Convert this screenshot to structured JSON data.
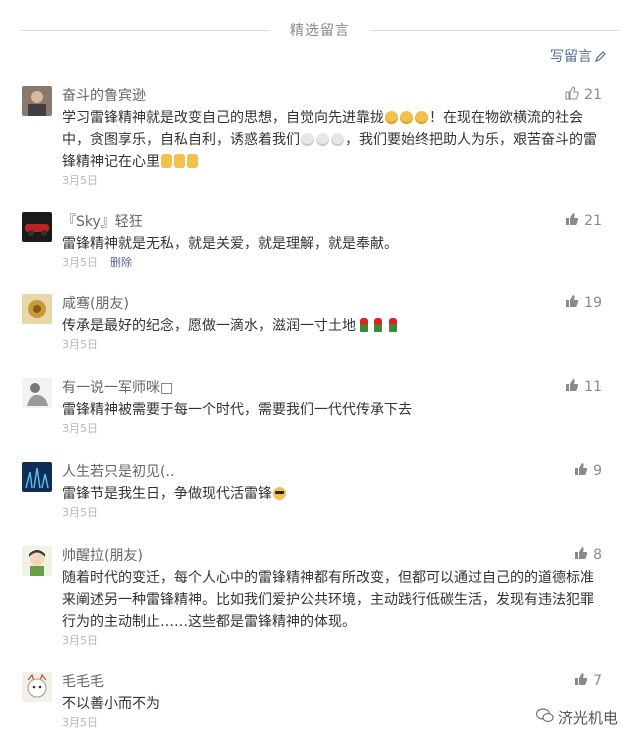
{
  "header": {
    "title": "精选留言"
  },
  "write_label": "写留言",
  "comments": [
    {
      "nickname": "奋斗的鲁宾逊",
      "likes": "21",
      "date": "3月5日",
      "text1": "学习雷锋精神就是改变自己的思想，自觉向先进靠拢",
      "text2": "！在现在物欲横流的社会中，贪图享乐，自私自利，诱惑着我们",
      "text3": "，我们要始终把助人为乐，艰苦奋斗的雷锋精神记在心里",
      "avatar_color": "#6b5a4e"
    },
    {
      "nickname": "『Sky』轻狂",
      "likes": "21",
      "date": "3月5日",
      "delete_label": "删除",
      "text1": "雷锋精神就是无私，就是关爱，就是理解，就是奉献。",
      "avatar_color": "#a33"
    },
    {
      "nickname": "咸骞(朋友)",
      "likes": "19",
      "date": "3月5日",
      "text1": "传承是最好的纪念，愿做一滴水，滋润一寸土地",
      "avatar_color": "#c9a44a"
    },
    {
      "nickname": "有一说一军师咪□",
      "likes": "11",
      "date": "3月5日",
      "text1": "雷锋精神被需要于每一个时代，需要我们一代代传承下去",
      "avatar_color": "#dcdcdc"
    },
    {
      "nickname": "人生若只是初见(..",
      "likes": "9",
      "date": "3月5日",
      "text1": "雷锋节是我生日，争做现代活雷锋",
      "avatar_color": "#1c4a7a"
    },
    {
      "nickname": "帅醒拉(朋友)",
      "likes": "8",
      "date": "3月5日",
      "text1": "随着时代的变迁，每个人心中的雷锋精神都有所改变，但都可以通过自己的的道德标准来阐述另一种雷锋精神。比如我们爱护公共环境，主动践行低碳生活，发现有违法犯罪行为的主动制止……这些都是雷锋精神的体现。",
      "avatar_color": "#8bb36a"
    },
    {
      "nickname": "毛毛毛",
      "likes": "7",
      "date": "3月5日",
      "text1": "不以善小而不为",
      "avatar_color": "#e9e4dc"
    }
  ],
  "watermark": "济光机电",
  "colors": {
    "link": "#576b95",
    "date": "#b7b7b7"
  }
}
